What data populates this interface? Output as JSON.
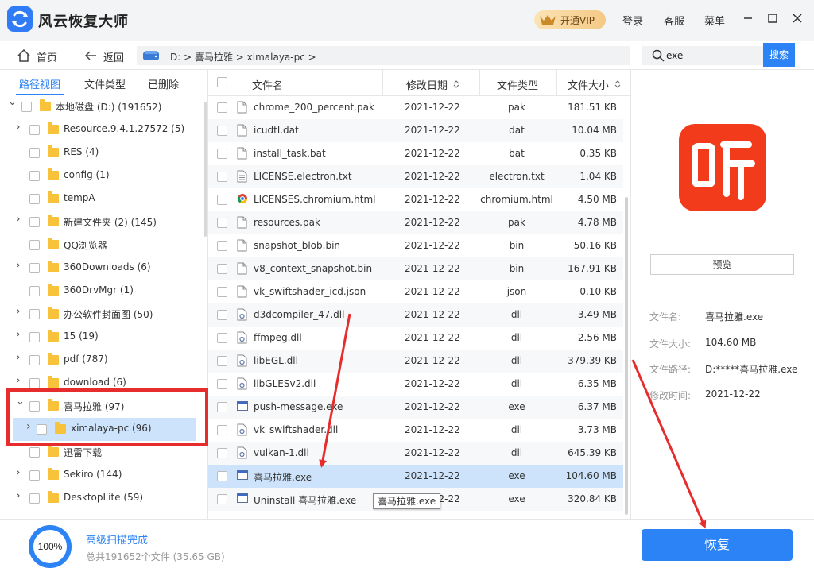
{
  "app": {
    "title": "风云恢复大师",
    "vip_label": "开通VIP",
    "login": "登录",
    "service": "客服",
    "menu": "菜单"
  },
  "nav": {
    "home": "首页",
    "back": "返回",
    "breadcrumb": "D:  >  喜马拉雅  >  ximalaya-pc  >",
    "search_value": "exe",
    "search_button": "搜索"
  },
  "left_tabs": [
    "路径视图",
    "文件类型",
    "已删除"
  ],
  "tree": [
    {
      "label": "本地磁盘 (D:) (191652)",
      "expand": "down",
      "level": 0
    },
    {
      "label": "Resource.9.4.1.27572 (5)",
      "expand": "right",
      "level": 1
    },
    {
      "label": "RES (4)",
      "expand": "",
      "level": 1
    },
    {
      "label": "config (1)",
      "expand": "",
      "level": 1
    },
    {
      "label": "tempA",
      "expand": "",
      "level": 1
    },
    {
      "label": "新建文件夹 (2) (145)",
      "expand": "right",
      "level": 1
    },
    {
      "label": "QQ浏览器",
      "expand": "",
      "level": 1
    },
    {
      "label": "360Downloads (6)",
      "expand": "right",
      "level": 1
    },
    {
      "label": "360DrvMgr (1)",
      "expand": "",
      "level": 1
    },
    {
      "label": "办公软件封面图 (50)",
      "expand": "right",
      "level": 1
    },
    {
      "label": "15 (19)",
      "expand": "right",
      "level": 1
    },
    {
      "label": "pdf (787)",
      "expand": "right",
      "level": 1
    },
    {
      "label": "download (6)",
      "expand": "right",
      "level": 1
    },
    {
      "label": "喜马拉雅 (97)",
      "expand": "down",
      "level": 1
    },
    {
      "label": "ximalaya-pc (96)",
      "expand": "right",
      "level": 2,
      "selected": true
    },
    {
      "label": "迅雷下载",
      "expand": "",
      "level": 1
    },
    {
      "label": "Sekiro (144)",
      "expand": "right",
      "level": 1
    },
    {
      "label": "DesktopLite (59)",
      "expand": "right",
      "level": 1
    }
  ],
  "table": {
    "headers": {
      "name": "文件名",
      "date": "修改日期",
      "type": "文件类型",
      "size": "文件大小"
    },
    "rows": [
      {
        "name": "chrome_200_percent.pak",
        "date": "2021-12-22",
        "type": "pak",
        "size": "181.51  KB",
        "icon": "file"
      },
      {
        "name": "icudtl.dat",
        "date": "2021-12-22",
        "type": "dat",
        "size": "10.04 MB",
        "icon": "file"
      },
      {
        "name": "install_task.bat",
        "date": "2021-12-22",
        "type": "bat",
        "size": "0.35  KB",
        "icon": "file"
      },
      {
        "name": "LICENSE.electron.txt",
        "date": "2021-12-22",
        "type": "electron.txt",
        "size": "1.04  KB",
        "icon": "text"
      },
      {
        "name": "LICENSES.chromium.html",
        "date": "2021-12-22",
        "type": "chromium.html",
        "size": "4.50 MB",
        "icon": "chrome"
      },
      {
        "name": "resources.pak",
        "date": "2021-12-22",
        "type": "pak",
        "size": "4.78 MB",
        "icon": "file"
      },
      {
        "name": "snapshot_blob.bin",
        "date": "2021-12-22",
        "type": "bin",
        "size": "50.16  KB",
        "icon": "file"
      },
      {
        "name": "v8_context_snapshot.bin",
        "date": "2021-12-22",
        "type": "bin",
        "size": "167.91  KB",
        "icon": "file"
      },
      {
        "name": "vk_swiftshader_icd.json",
        "date": "2021-12-22",
        "type": "json",
        "size": "0.10  KB",
        "icon": "file"
      },
      {
        "name": "d3dcompiler_47.dll",
        "date": "2021-12-22",
        "type": "dll",
        "size": "3.49 MB",
        "icon": "dll"
      },
      {
        "name": "ffmpeg.dll",
        "date": "2021-12-22",
        "type": "dll",
        "size": "2.56 MB",
        "icon": "dll"
      },
      {
        "name": "libEGL.dll",
        "date": "2021-12-22",
        "type": "dll",
        "size": "379.39  KB",
        "icon": "dll"
      },
      {
        "name": "libGLESv2.dll",
        "date": "2021-12-22",
        "type": "dll",
        "size": "6.35 MB",
        "icon": "dll"
      },
      {
        "name": "push-message.exe",
        "date": "2021-12-22",
        "type": "exe",
        "size": "6.37 MB",
        "icon": "exe"
      },
      {
        "name": "vk_swiftshader.dll",
        "date": "2021-12-22",
        "type": "dll",
        "size": "3.73 MB",
        "icon": "dll"
      },
      {
        "name": "vulkan-1.dll",
        "date": "2021-12-22",
        "type": "dll",
        "size": "645.39  KB",
        "icon": "dll"
      },
      {
        "name": "喜马拉雅.exe",
        "date": "2021-12-22",
        "type": "exe",
        "size": "104.60 MB",
        "icon": "exe",
        "selected": true
      },
      {
        "name": "Uninstall 喜马拉雅.exe",
        "date": "2021-12-22",
        "type": "exe",
        "size": "320.84  KB",
        "icon": "exe"
      }
    ],
    "tooltip": "喜马拉雅.exe"
  },
  "preview": {
    "button": "预览",
    "labels": {
      "name": "文件名:",
      "size": "文件大小:",
      "path": "文件路径:",
      "mtime": "修改时间:"
    },
    "values": {
      "name": "喜马拉雅.exe",
      "size": "104.60 MB",
      "path": "D:*****喜马拉雅.exe",
      "mtime": "2021-12-22"
    }
  },
  "status": {
    "percent": "100%",
    "progress": 1.0,
    "title": "高级扫描完成",
    "summary": "总共191652个文件 (35.65 GB)"
  },
  "recover_button": "恢复",
  "colors": {
    "accent": "#2b83f6",
    "annotation": "#e62c2c",
    "app_icon": "#f23b1b",
    "selected_row": "#cde3fb"
  }
}
